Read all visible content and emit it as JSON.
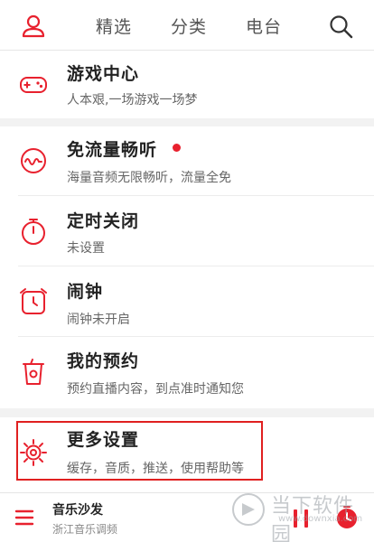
{
  "topbar": {
    "tabs": [
      "精选",
      "分类",
      "电台"
    ],
    "icons": {
      "user": "user-icon",
      "search": "search-icon"
    }
  },
  "menu": {
    "items": [
      {
        "title": "游戏中心",
        "subtitle": "人本艰,一场游戏一场梦",
        "icon": "gamepad-icon"
      },
      {
        "title": "免流量畅听",
        "subtitle": "海量音频无限畅听，流量全免",
        "icon": "wave-icon",
        "badge": "red-dot"
      },
      {
        "title": "定时关闭",
        "subtitle": "未设置",
        "icon": "stopwatch-icon"
      },
      {
        "title": "闹钟",
        "subtitle": "闹钟未开启",
        "icon": "alarm-clock-icon"
      },
      {
        "title": "我的预约",
        "subtitle": "预约直播内容，到点准时通知您",
        "icon": "cup-icon"
      },
      {
        "title": "更多设置",
        "subtitle": "缓存，音质，推送，使用帮助等",
        "icon": "settings-icon"
      }
    ]
  },
  "player": {
    "song": "音乐沙发",
    "artist": "浙江音乐调频"
  },
  "watermark": {
    "text": "当下软件园",
    "url": "www.downxia.com"
  },
  "colors": {
    "accent": "#e8212e",
    "highlight_border": "#e02020"
  }
}
